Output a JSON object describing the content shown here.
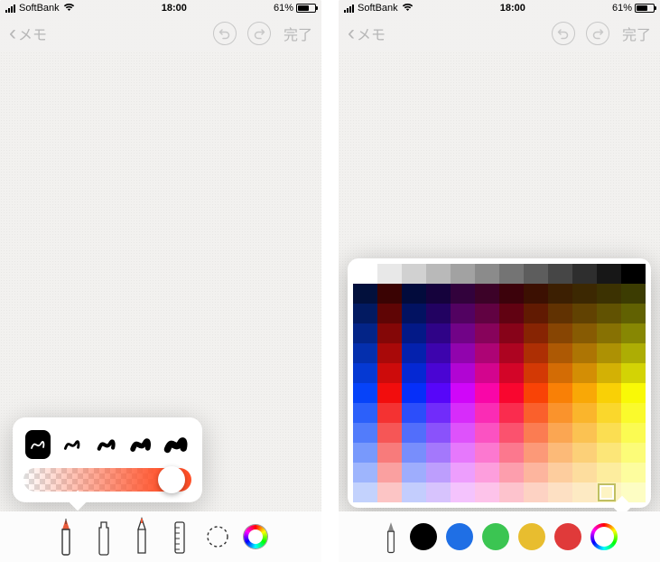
{
  "status": {
    "carrier": "SoftBank",
    "time": "18:00",
    "battery_pct": "61%",
    "battery_fill": 0.61
  },
  "nav": {
    "back_label": "メモ",
    "done_label": "完了"
  },
  "tools_left": {
    "items": [
      "pen",
      "marker",
      "pencil",
      "ruler",
      "lasso",
      "color-picker"
    ],
    "selected": "pen"
  },
  "stroke_popover": {
    "selected_index": 0,
    "stroke_count": 5,
    "opacity": 0.88
  },
  "swatches": {
    "colors": [
      "#000000",
      "#1f6fe5",
      "#3bc552",
      "#e8bd2f",
      "#e03a3a"
    ],
    "selected_index": 5
  },
  "color_grid": {
    "rows": 12,
    "cols": 12,
    "hues": [
      0,
      0,
      230,
      260,
      290,
      320,
      350,
      15,
      30,
      40,
      50,
      60
    ],
    "selected_row": 11,
    "selected_col": 10
  }
}
